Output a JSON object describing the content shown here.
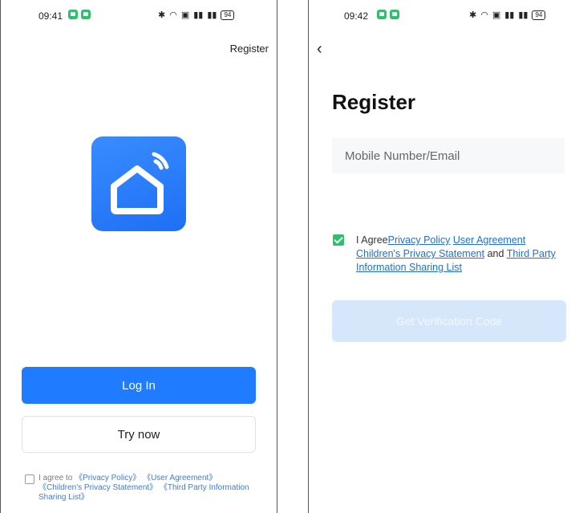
{
  "left_screen": {
    "status": {
      "time": "09:41",
      "battery": "94"
    },
    "register_label": "Register",
    "login_label": "Log In",
    "try_now_label": "Try now",
    "agreement": {
      "prefix": "I agree to",
      "privacy": "《Privacy Policy》",
      "user_agreement": "《User Agreement》",
      "children": "《Children's Privacy Statement》",
      "third_party": "《Third Party Information Sharing List》"
    }
  },
  "right_screen": {
    "status": {
      "time": "09:42",
      "battery": "94"
    },
    "title": "Register",
    "input_placeholder": "Mobile Number/Email",
    "agreement": {
      "prefix": "I Agree",
      "privacy": "Privacy Policy",
      "user_agreement": "User Agreement",
      "children": "Children's Privacy Statement",
      "and": "and",
      "third_party": "Third Party Information Sharing List"
    },
    "button_label": "Get Verification Code"
  },
  "colors": {
    "primary": "#1f7bff",
    "disabled_button": "#d7e7fb",
    "checkbox_checked": "#2ec06a",
    "link": "#1f6fe0"
  },
  "icons": [
    "app-logo-home-wifi-icon",
    "back-arrow-icon",
    "bluetooth-icon",
    "wifi-icon",
    "signal-icon",
    "battery-icon"
  ]
}
